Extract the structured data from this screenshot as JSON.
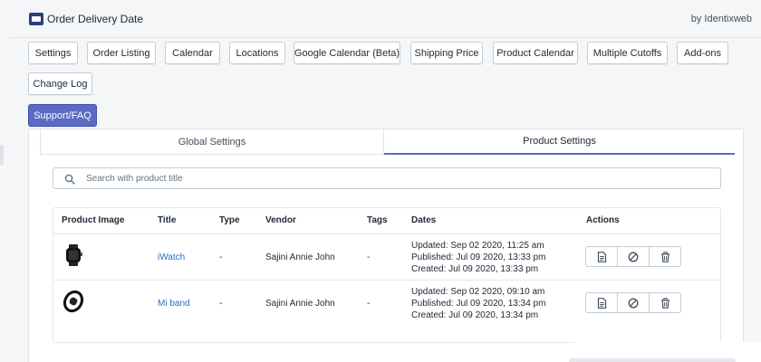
{
  "app": {
    "title": "Order Delivery Date",
    "by": "by Identixweb",
    "logo_icon": "calendar-logo-icon"
  },
  "nav": {
    "buttons": [
      {
        "label": "Settings"
      },
      {
        "label": "Order Listing"
      },
      {
        "label": "Calendar"
      },
      {
        "label": "Locations"
      },
      {
        "label": "Google Calendar (Beta)"
      },
      {
        "label": "Shipping Price"
      },
      {
        "label": "Product Calendar"
      },
      {
        "label": "Multiple Cutoffs"
      },
      {
        "label": "Add-ons"
      },
      {
        "label": "Change Log"
      },
      {
        "label": "Support/FAQ",
        "primary": true
      }
    ]
  },
  "tabs": [
    {
      "label": "Global Settings",
      "selected": false
    },
    {
      "label": "Product Settings",
      "selected": true
    }
  ],
  "search": {
    "placeholder": "Search with product title",
    "value": ""
  },
  "table": {
    "headers": [
      "Product Image",
      "Title",
      "Type",
      "Vendor",
      "Tags",
      "Dates",
      "Actions"
    ],
    "rows": [
      {
        "image_icon": "watch-icon",
        "title": "iWatch",
        "type": "-",
        "vendor": "Sajini Annie John",
        "tags": "-",
        "dates": [
          "Updated: Sep 02 2020, 11:25 am",
          "Published: Jul 09 2020, 13:33 pm",
          "Created: Jul 09 2020, 13:33 pm"
        ]
      },
      {
        "image_icon": "band-icon",
        "title": "Mi band",
        "type": "-",
        "vendor": "Sajini Annie John",
        "tags": "-",
        "dates": [
          "Updated: Sep 02 2020, 09:10 am",
          "Published: Jul 09 2020, 13:34 pm",
          "Created: Jul 09 2020, 13:34 pm"
        ]
      }
    ],
    "action_icons": [
      "document-icon",
      "disable-icon",
      "trash-icon"
    ]
  },
  "colors": {
    "primary": "#5c6ac4",
    "link": "#2c6ecb"
  }
}
